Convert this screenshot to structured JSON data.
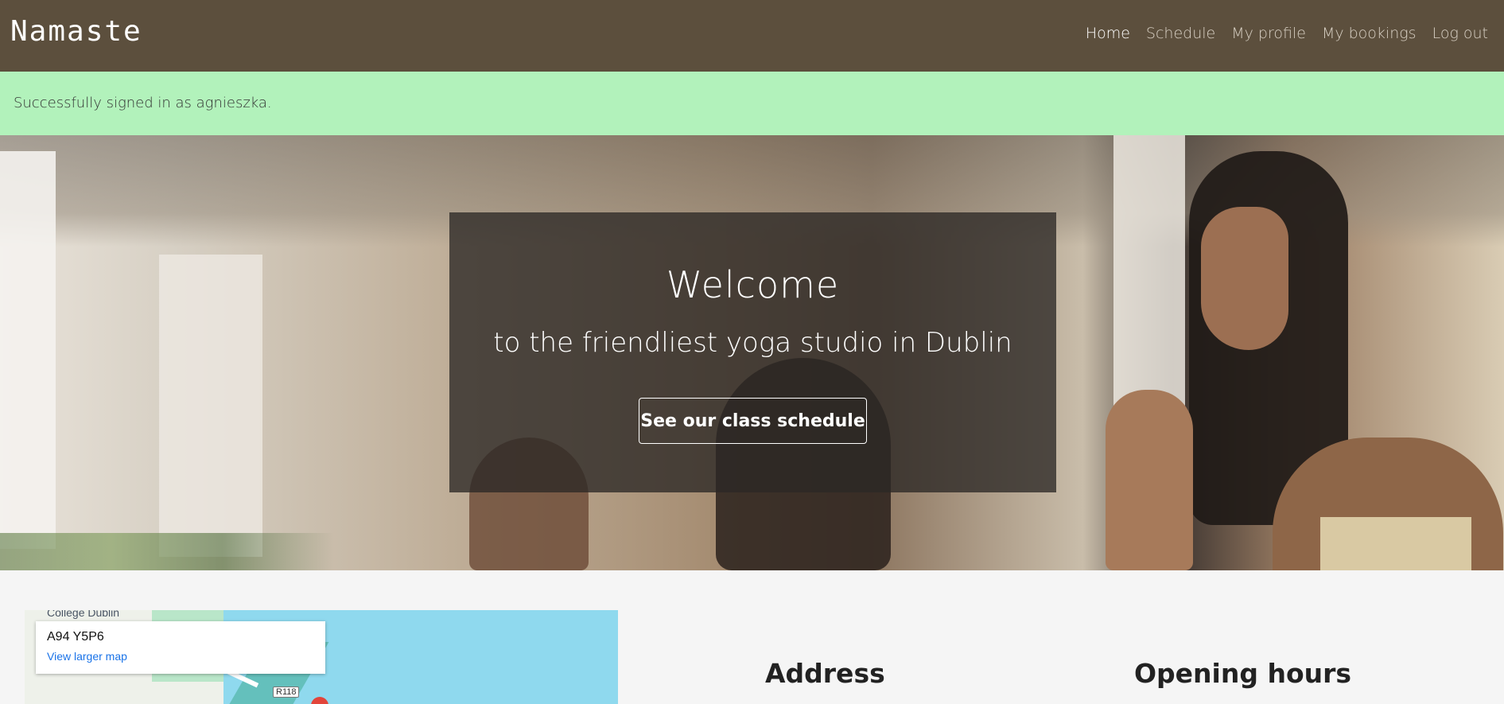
{
  "navbar": {
    "brand": "Namaste",
    "links": [
      "Home",
      "Schedule",
      "My profile",
      "My bookings",
      "Log out"
    ],
    "active": "Home",
    "colors": {
      "background": "#5c4f3d",
      "link": "#d8d0c4",
      "active_link": "#ffffff"
    }
  },
  "alert": {
    "message": "Successfully signed in as agnieszka.",
    "color": "#b2f2bb"
  },
  "hero": {
    "title": "Welcome",
    "subtitle": "to the friendliest yoga studio in Dublin",
    "button_label": "See our class schedule"
  },
  "map": {
    "place_label": "College Dublin",
    "card_title": "A94 Y5P6",
    "card_link": "View larger map",
    "road_label": "R118"
  },
  "info": {
    "address_title": "Address",
    "hours_title": "Opening hours"
  }
}
